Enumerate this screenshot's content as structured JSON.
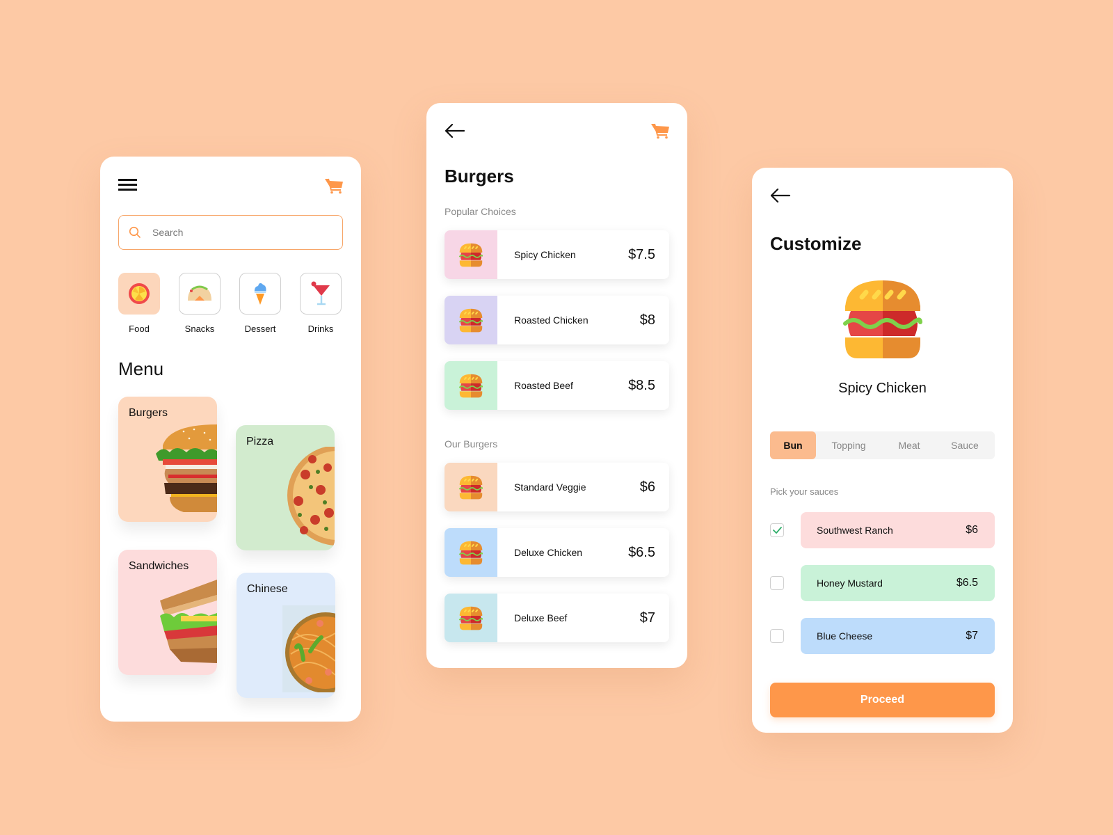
{
  "colors": {
    "background": "#fdc9a5",
    "accent": "#fe974a",
    "cart": "#fe974a"
  },
  "home": {
    "search": {
      "placeholder": "Search",
      "value": ""
    },
    "categories": [
      {
        "label": "Food",
        "icon": "food-icon",
        "active": true
      },
      {
        "label": "Snacks",
        "icon": "taco-icon",
        "active": false
      },
      {
        "label": "Dessert",
        "icon": "ice-cream-icon",
        "active": false
      },
      {
        "label": "Drinks",
        "icon": "cocktail-icon",
        "active": false
      }
    ],
    "menu_title": "Menu",
    "menu_cards": [
      {
        "label": "Burgers",
        "color": "#fdd7bd"
      },
      {
        "label": "Pizza",
        "color": "#d2ebce"
      },
      {
        "label": "Sandwiches",
        "color": "#fddcdc"
      },
      {
        "label": "Chinese",
        "color": "#dfebfb"
      }
    ]
  },
  "burgers": {
    "title": "Burgers",
    "popular_label": "Popular Choices",
    "popular": [
      {
        "name": "Spicy Chicken",
        "price": "$7.5",
        "color": "#f7d6e6"
      },
      {
        "name": "Roasted Chicken",
        "price": "$8",
        "color": "#d8d3f3"
      },
      {
        "name": "Roasted Beef",
        "price": "$8.5",
        "color": "#c9f2d8"
      }
    ],
    "ours_label": "Our Burgers",
    "ours": [
      {
        "name": "Standard Veggie",
        "price": "$6",
        "color": "#fad8bf"
      },
      {
        "name": "Deluxe Chicken",
        "price": "$6.5",
        "color": "#bddcfb"
      },
      {
        "name": "Deluxe Beef",
        "price": "$7",
        "color": "#c7e7ee"
      }
    ]
  },
  "customize": {
    "title": "Customize",
    "product": "Spicy Chicken",
    "tabs": [
      {
        "label": "Bun",
        "active": true
      },
      {
        "label": "Topping",
        "active": false
      },
      {
        "label": "Meat",
        "active": false
      },
      {
        "label": "Sauce",
        "active": false
      }
    ],
    "sauces_label": "Pick your sauces",
    "sauces": [
      {
        "name": "Southwest Ranch",
        "price": "$6",
        "checked": true,
        "color": "#fddcdc"
      },
      {
        "name": "Honey Mustard",
        "price": "$6.5",
        "checked": false,
        "color": "#c9f2d8"
      },
      {
        "name": "Blue Cheese",
        "price": "$7",
        "checked": false,
        "color": "#bddcfb"
      }
    ],
    "proceed_label": "Proceed"
  }
}
